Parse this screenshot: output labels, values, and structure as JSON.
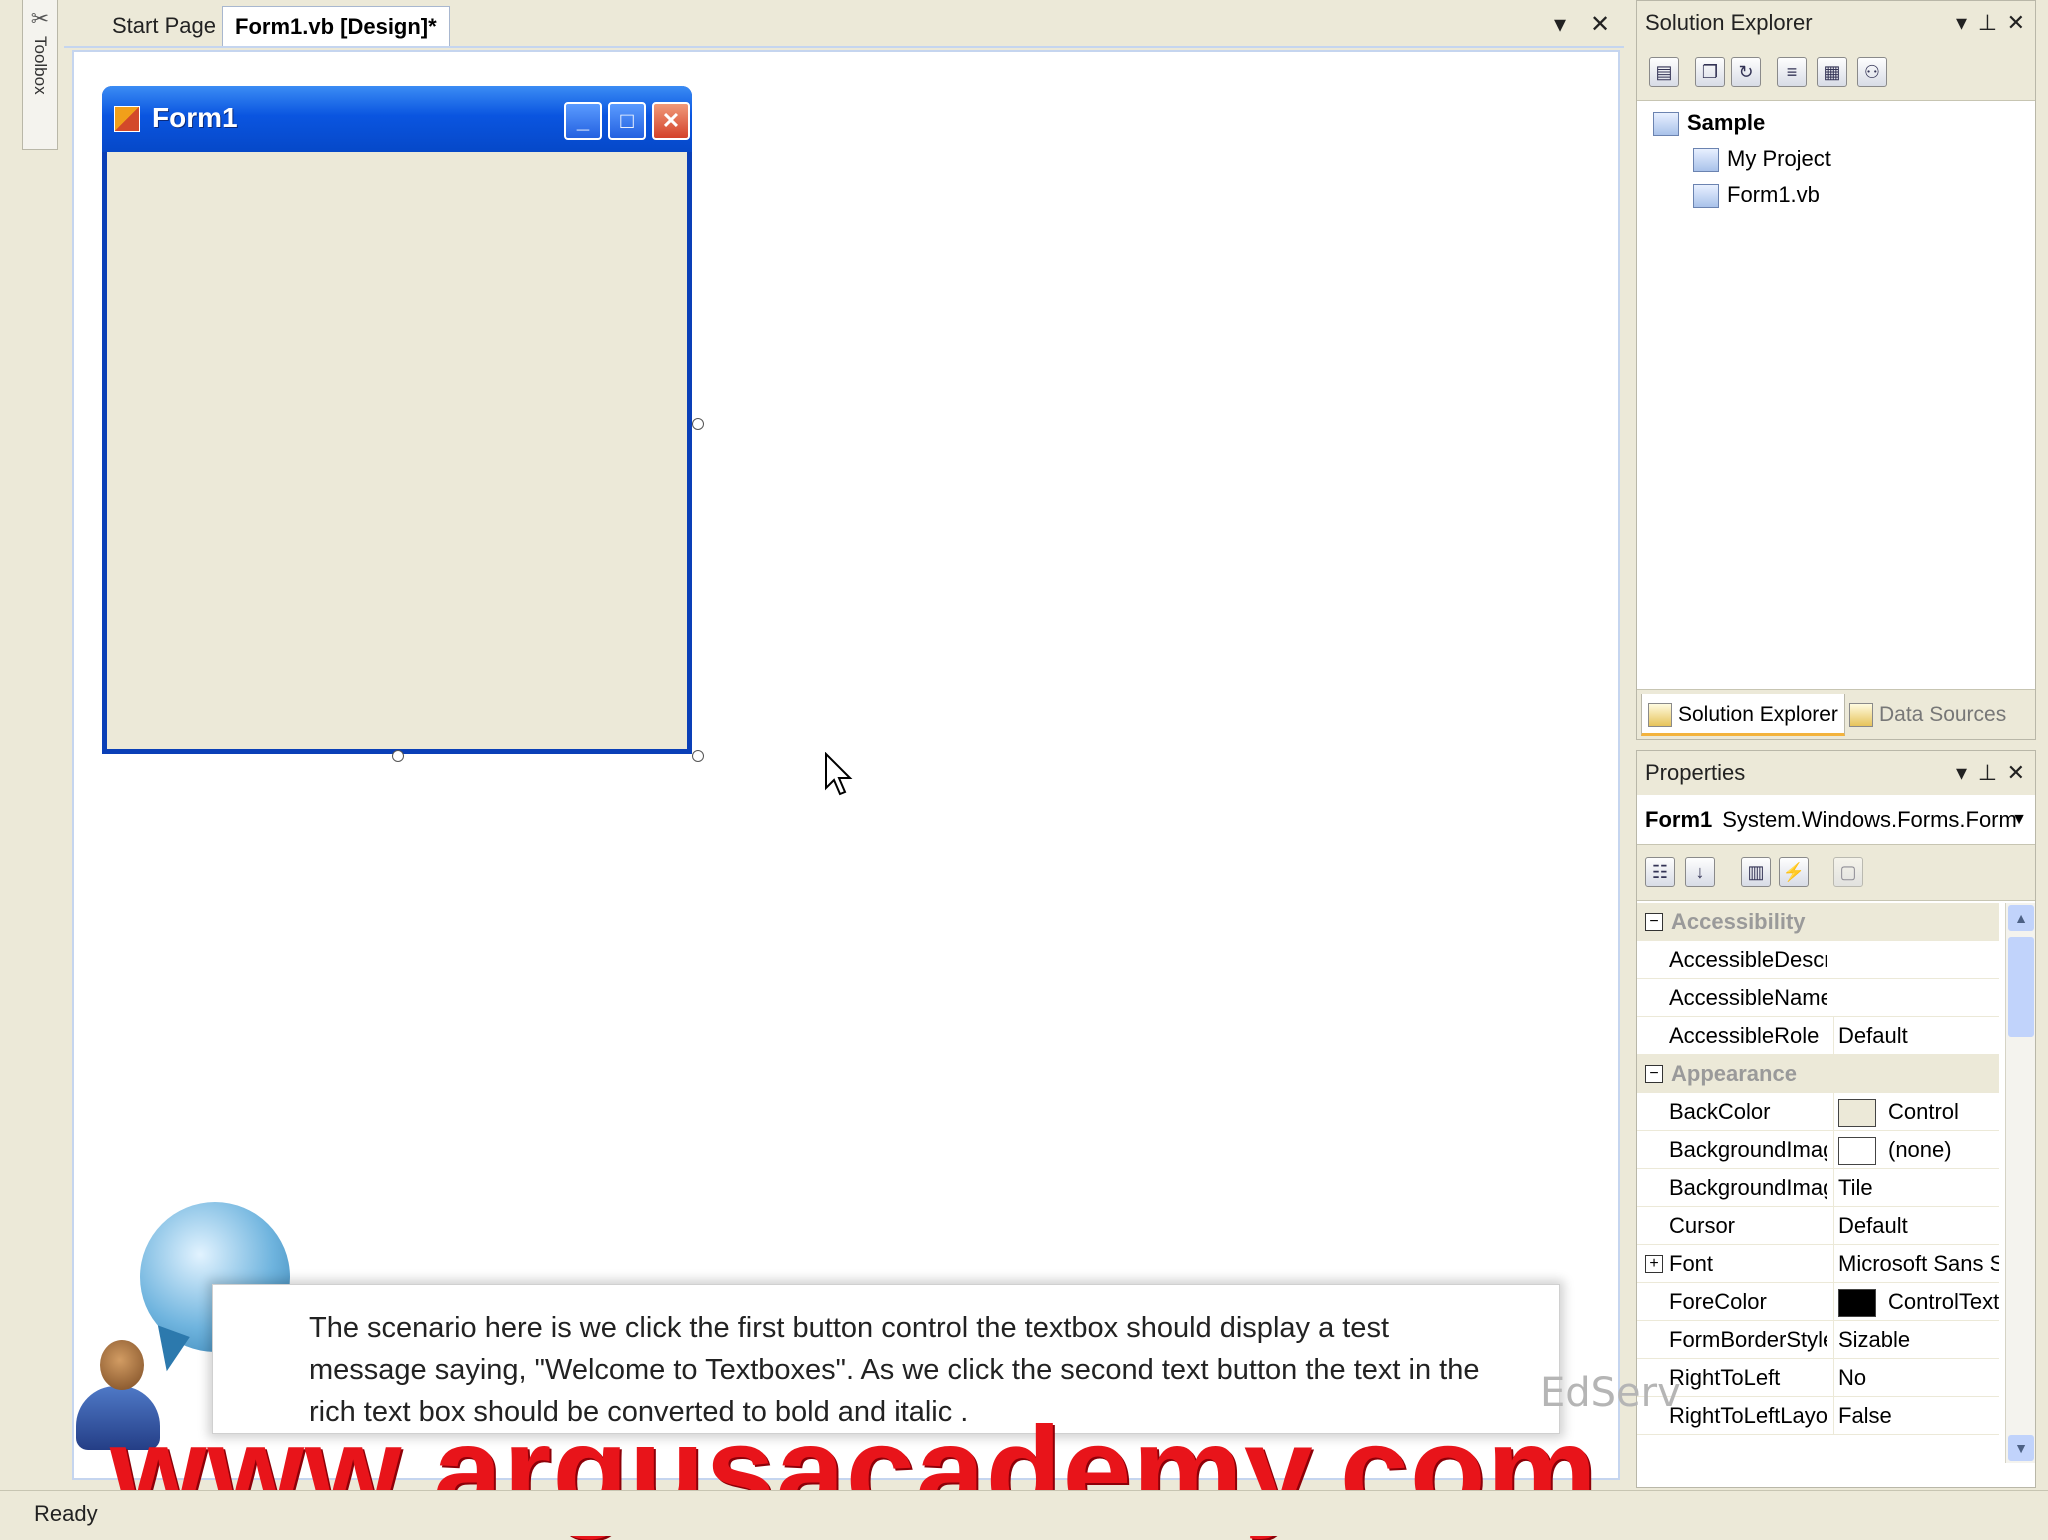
{
  "toolbox": {
    "label": "Toolbox"
  },
  "doc_tabs": {
    "start_page": "Start Page",
    "active": "Form1.vb [Design]*",
    "dropdown_icon": "chevron-down-icon",
    "close_icon": "close-icon"
  },
  "form1": {
    "title": "Form1",
    "back_color": "#ece9d8",
    "title_color": "#0a55e0"
  },
  "solution_explorer": {
    "title": "Solution Explorer",
    "toolbar_icons": [
      "properties-icon",
      "show-all-files-icon",
      "refresh-icon",
      "view-code-icon",
      "view-designer-icon",
      "class-view-icon"
    ],
    "tree": {
      "root": "Sample",
      "children": [
        "My Project",
        "Form1.vb"
      ]
    },
    "bottom_tabs": [
      "Solution Explorer",
      "Data Sources"
    ]
  },
  "properties": {
    "title": "Properties",
    "object_name": "Form1",
    "object_type": "System.Windows.Forms.Form",
    "categories": {
      "accessibility": {
        "name": "Accessibility",
        "rows": [
          {
            "name": "AccessibleDescription",
            "value": ""
          },
          {
            "name": "AccessibleName",
            "value": ""
          },
          {
            "name": "AccessibleRole",
            "value": "Default"
          }
        ]
      },
      "appearance": {
        "name": "Appearance",
        "rows": [
          {
            "name": "BackColor",
            "value": "Control",
            "swatch": "#ece9d8"
          },
          {
            "name": "BackgroundImage",
            "value": "(none)",
            "swatch": "#ffffff"
          },
          {
            "name": "BackgroundImageLayout",
            "value": "Tile"
          },
          {
            "name": "Cursor",
            "value": "Default"
          },
          {
            "name": "Font",
            "value": "Microsoft Sans Serif"
          },
          {
            "name": "ForeColor",
            "value": "ControlText",
            "swatch": "#000000"
          },
          {
            "name": "FormBorderStyle",
            "value": "Sizable"
          },
          {
            "name": "RightToLeft",
            "value": "No"
          },
          {
            "name": "RightToLeftLayout",
            "value": "False"
          }
        ]
      }
    }
  },
  "callout": {
    "text": "The scenario here is we click the first button control the textbox should display a test message saying, \"Welcome to Textboxes\". As we click the second text button the text in the rich text box should be converted to bold and italic ."
  },
  "watermark": "EdServ",
  "banner": {
    "url": "www.argusacademy.com",
    "color": "#e8141a"
  },
  "status_bar": {
    "text": "Ready"
  }
}
